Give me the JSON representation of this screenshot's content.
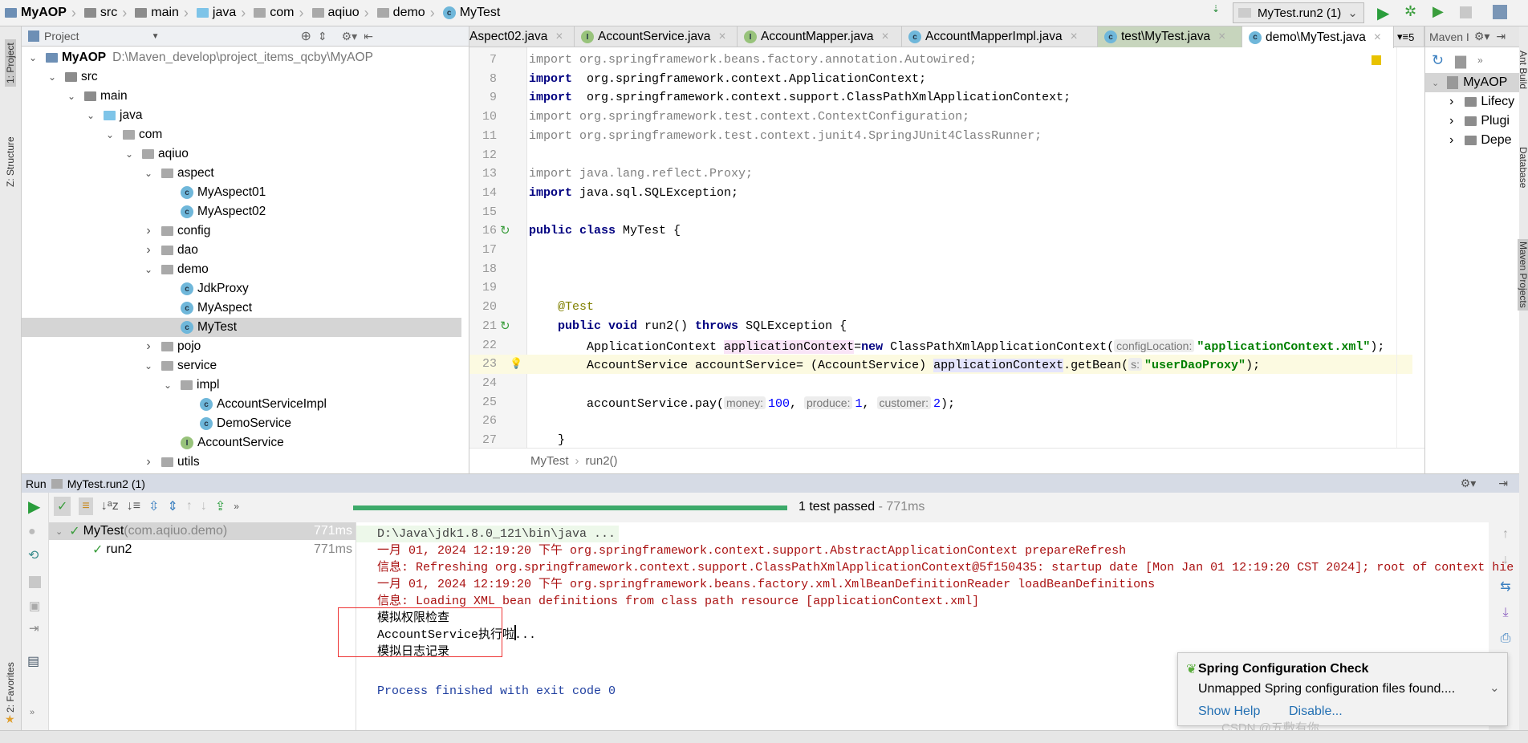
{
  "breadcrumb": [
    "MyAOP",
    "src",
    "main",
    "java",
    "com",
    "aqiuo",
    "demo",
    "MyTest"
  ],
  "toolbar": {
    "run_config": "MyTest.run2 (1)"
  },
  "left_stripe": {
    "project": "1: Project",
    "structure": "Z: Structure",
    "favorites": "2: Favorites"
  },
  "right_stripe": {
    "ant": "Ant Build",
    "database": "Database",
    "maven": "Maven Projects"
  },
  "project": {
    "title": "Project",
    "tree": [
      {
        "level": 0,
        "name": "MyAOP",
        "type": "module",
        "state": "open",
        "suffix": "D:\\Maven_develop\\project_items_qcby\\MyAOP"
      },
      {
        "level": 1,
        "name": "src",
        "type": "folder",
        "state": "open"
      },
      {
        "level": 2,
        "name": "main",
        "type": "folder",
        "state": "open"
      },
      {
        "level": 3,
        "name": "java",
        "type": "source",
        "state": "open"
      },
      {
        "level": 4,
        "name": "com",
        "type": "package",
        "state": "open"
      },
      {
        "level": 5,
        "name": "aqiuo",
        "type": "package",
        "state": "open"
      },
      {
        "level": 6,
        "name": "aspect",
        "type": "package",
        "state": "open"
      },
      {
        "level": 7,
        "name": "MyAspect01",
        "type": "class"
      },
      {
        "level": 7,
        "name": "MyAspect02",
        "type": "class"
      },
      {
        "level": 6,
        "name": "config",
        "type": "package",
        "state": "closed"
      },
      {
        "level": 6,
        "name": "dao",
        "type": "package",
        "state": "closed"
      },
      {
        "level": 6,
        "name": "demo",
        "type": "package",
        "state": "open"
      },
      {
        "level": 7,
        "name": "JdkProxy",
        "type": "class"
      },
      {
        "level": 7,
        "name": "MyAspect",
        "type": "class"
      },
      {
        "level": 7,
        "name": "MyTest",
        "type": "testclass",
        "selected": true
      },
      {
        "level": 6,
        "name": "pojo",
        "type": "package",
        "state": "closed"
      },
      {
        "level": 6,
        "name": "service",
        "type": "package",
        "state": "open"
      },
      {
        "level": 7,
        "name": "impl",
        "type": "package",
        "state": "open"
      },
      {
        "level": 8,
        "name": "AccountServiceImpl",
        "type": "class"
      },
      {
        "level": 8,
        "name": "DemoService",
        "type": "class"
      },
      {
        "level": 7,
        "name": "AccountService",
        "type": "interface"
      },
      {
        "level": 6,
        "name": "utils",
        "type": "package",
        "state": "closed"
      }
    ]
  },
  "editor": {
    "tabs": [
      {
        "label": "Aspect02.java",
        "icon": "class"
      },
      {
        "label": "AccountService.java",
        "icon": "interface"
      },
      {
        "label": "AccountMapper.java",
        "icon": "interface"
      },
      {
        "label": "AccountMapperImpl.java",
        "icon": "class"
      },
      {
        "label": "test\\MyTest.java",
        "icon": "testclass"
      },
      {
        "label": "demo\\MyTest.java",
        "icon": "testclass",
        "active": true
      }
    ],
    "tab_overflow": "5",
    "lines": [
      {
        "n": "7",
        "t": [
          [
            "gr",
            "import org.springframework.beans.factory.annotation.Autowired;"
          ]
        ]
      },
      {
        "n": "8",
        "t": [
          [
            "kw",
            "import"
          ],
          [
            "",
            "  org.springframework.context.ApplicationContext;"
          ]
        ]
      },
      {
        "n": "9",
        "t": [
          [
            "kw",
            "import"
          ],
          [
            "",
            "  org.springframework.context.support.ClassPathXmlApplicationContext;"
          ]
        ]
      },
      {
        "n": "10",
        "t": [
          [
            "gr",
            "import org.springframework.test.context.ContextConfiguration;"
          ]
        ]
      },
      {
        "n": "11",
        "t": [
          [
            "gr",
            "import org.springframework.test.context.junit4.SpringJUnit4ClassRunner;"
          ]
        ]
      },
      {
        "n": "12",
        "t": []
      },
      {
        "n": "13",
        "t": [
          [
            "gr",
            "import java.lang.reflect.Proxy;"
          ]
        ]
      },
      {
        "n": "14",
        "t": [
          [
            "kw",
            "import"
          ],
          [
            "",
            " java.sql.SQLException;"
          ]
        ]
      },
      {
        "n": "15",
        "t": []
      },
      {
        "n": "16",
        "t": [
          [
            "kw",
            "public class"
          ],
          [
            "",
            " MyTest {"
          ]
        ]
      },
      {
        "n": "17",
        "t": []
      },
      {
        "n": "18",
        "t": []
      },
      {
        "n": "19",
        "t": []
      },
      {
        "n": "20",
        "t": [
          [
            "ann",
            "    @Test"
          ]
        ]
      },
      {
        "n": "21",
        "t": [
          [
            "kw",
            "    public void"
          ],
          [
            "",
            " run2() "
          ],
          [
            "kw",
            "throws"
          ],
          [
            "",
            " SQLException {"
          ]
        ]
      },
      {
        "n": "22",
        "t": [
          [
            "",
            "        ApplicationContext "
          ],
          [
            "vpink",
            "applicationContext"
          ],
          [
            "",
            "="
          ],
          [
            "kw",
            "new"
          ],
          [
            "",
            " ClassPathXmlApplicationContext("
          ],
          [
            "hint",
            "configLocation:"
          ],
          [
            "str",
            "\"applicationContext.xml\""
          ],
          [
            "",
            ");"
          ]
        ]
      },
      {
        "n": "23",
        "hl": true,
        "t": [
          [
            "",
            "        AccountService accountService= (AccountService) "
          ],
          [
            "vlav",
            "applicationContext"
          ],
          [
            "",
            ".getBean("
          ],
          [
            "hint",
            "s:"
          ],
          [
            "str",
            "\"userDaoProxy\""
          ],
          [
            "",
            ");"
          ]
        ]
      },
      {
        "n": "24",
        "t": []
      },
      {
        "n": "25",
        "t": [
          [
            "",
            "        accountService.pay("
          ],
          [
            "hint",
            "money:"
          ],
          [
            "num",
            "100"
          ],
          [
            "",
            ", "
          ],
          [
            "hint",
            "produce:"
          ],
          [
            "num",
            "1"
          ],
          [
            "",
            ", "
          ],
          [
            "hint",
            "customer:"
          ],
          [
            "num",
            "2"
          ],
          [
            "",
            ");"
          ]
        ]
      },
      {
        "n": "26",
        "t": []
      },
      {
        "n": "27",
        "t": [
          [
            "",
            "    }"
          ]
        ]
      },
      {
        "n": "28",
        "t": []
      },
      {
        "n": "29",
        "t": [
          [
            "",
            "}"
          ]
        ]
      }
    ],
    "breadcrumb": [
      "MyTest",
      "run2()"
    ]
  },
  "maven": {
    "title": "Maven I",
    "root": "MyAOP",
    "items": [
      "Lifecy",
      "Plugi",
      "Depe"
    ]
  },
  "run": {
    "label": "Run",
    "config": "MyTest.run2 (1)",
    "status": "1 test passed",
    "duration": " - 771ms",
    "progress": 100,
    "tests": [
      {
        "name": "MyTest",
        "pkg": " (com.aqiuo.demo)",
        "time": "771ms"
      },
      {
        "name": "run2",
        "time": "771ms"
      }
    ],
    "console": [
      {
        "c": "cmd",
        "t": "D:\\Java\\jdk1.8.0_121\\bin\\java ..."
      },
      {
        "c": "red",
        "t": "一月 01, 2024 12:19:20 下午 org.springframework.context.support.AbstractApplicationContext prepareRefresh"
      },
      {
        "c": "red",
        "t": "信息: Refreshing org.springframework.context.support.ClassPathXmlApplicationContext@5f150435: startup date [Mon Jan 01 12:19:20 CST 2024]; root of context hie"
      },
      {
        "c": "red",
        "t": "一月 01, 2024 12:19:20 下午 org.springframework.beans.factory.xml.XmlBeanDefinitionReader loadBeanDefinitions"
      },
      {
        "c": "red",
        "t": "信息: Loading XML bean definitions from class path resource [applicationContext.xml]"
      },
      {
        "c": "out",
        "t": "模拟权限检查"
      },
      {
        "c": "out",
        "t": "AccountService执行啦..."
      },
      {
        "c": "out",
        "t": "模拟日志记录"
      },
      {
        "c": "blank",
        "t": ""
      },
      {
        "c": "exit",
        "t": "Process finished with exit code 0"
      }
    ]
  },
  "notification": {
    "title": "Spring Configuration Check",
    "body": "Unmapped Spring configuration files found....",
    "show_help": "Show Help",
    "disable": "Disable..."
  },
  "watermark": "CSDN @五敷有你",
  "colors": {
    "accent_green": "#3daa6a",
    "progress": "#3daa6a",
    "error_text": "#aa1111",
    "link": "#2470b3"
  }
}
